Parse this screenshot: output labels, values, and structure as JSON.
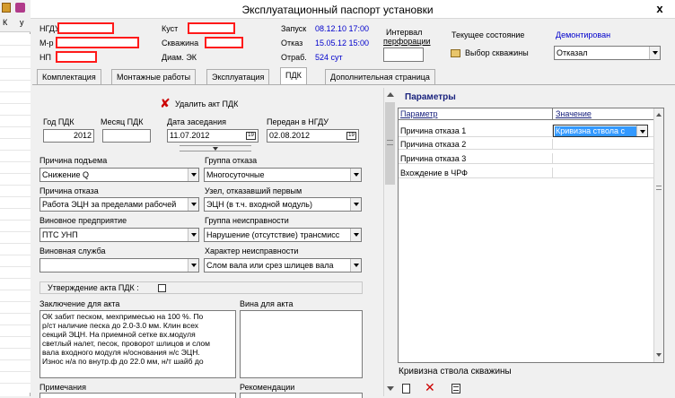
{
  "window": {
    "title": "Эксплуатационный паспорт установки",
    "close_label": "x"
  },
  "header": {
    "ngdu_label": "НГДУ",
    "mr_label": "М-р",
    "np_label": "НП",
    "kust_label": "Куст",
    "skv_label": "Скважина",
    "diam_label": "Диам. ЭК",
    "zapusk_label": "Запуск",
    "zapusk_value": "08.12.10 17:00",
    "otkaz_label": "Отказ",
    "otkaz_value": "15.05.12 15:00",
    "otrab_label": "Отраб.",
    "otrab_value": "524 сут",
    "interval_label_1": "Интервал",
    "interval_label_2": "перфорации",
    "state_label": "Текущее состояние",
    "state_value": "Демонтирован",
    "choose_well_label": "Выбор скважины",
    "status_combo_value": "Отказал"
  },
  "tabs": [
    {
      "label": "Комплектация"
    },
    {
      "label": "Монтажные работы"
    },
    {
      "label": "Эксплуатация"
    },
    {
      "label": "ПДК"
    },
    {
      "label": "Дополнительная страница"
    }
  ],
  "left_strip": {
    "label_1": "К",
    "label_2": "у"
  },
  "pdk": {
    "delete_label": "Удалить акт ПДК",
    "year_label": "Год ПДК",
    "year_value": "2012",
    "month_label": "Месяц ПДК",
    "month_value": "",
    "meeting_date_label": "Дата заседания",
    "meeting_date_value": "11.07.2012",
    "transfer_label": "Передан в НГДУ",
    "transfer_value": "02.08.2012",
    "lift_reason_label": "Причина подъема",
    "lift_reason_value": "Снижение Q",
    "failure_group_label": "Группа отказа",
    "failure_group_value": "Многосуточные",
    "failure_reason_label": "Причина отказа",
    "failure_reason_value": "Работа ЭЦН за пределами рабочей",
    "first_node_label": "Узел, отказавший первым",
    "first_node_value": "ЭЦН (в т.ч. входной модуль)",
    "culprit_label": "Виновное предприятие",
    "culprit_value": "ПТС УНП",
    "malfunction_group_label": "Группа неисправности",
    "malfunction_group_value": "Нарушение (отсутствие) трансмисс",
    "culprit_service_label": "Виновная служба",
    "culprit_service_value": "",
    "malfunction_char_label": "Характер неисправности",
    "malfunction_char_value": "Слом вала или срез шлицев вала",
    "approval_label": "Утверждение акта ПДК :",
    "conclusion_label": "Заключение для акта",
    "conclusion_lines": [
      "ОК забит песком, мехпримесью на 100 %. По",
      "р/ст наличие песка до 2.0-3.0 мм. Клин всех",
      "секций ЭЦН. На приемной сетке вх.модуля",
      "светлый налет, песок, проворот шлицов и слом",
      "вала входного модуля н/основания н/с ЭЦН.",
      "Износ н/а по внутр.ф до 22.0 мм, н/т шайб до"
    ],
    "guilt_label": "Вина для акта",
    "notes_label": "Примечания",
    "recommend_label": "Рекомендации"
  },
  "params": {
    "title": "Параметры",
    "col_param": "Параметр",
    "col_value": "Значение",
    "rows": [
      {
        "name": "Причина отказа 1",
        "value": "Кривизна ствола с"
      },
      {
        "name": "Причина отказа 2",
        "value": ""
      },
      {
        "name": "Причина отказа 3",
        "value": ""
      },
      {
        "name": "Вхождение в ЧРФ",
        "value": ""
      }
    ],
    "footer_text": "Кривизна ствола скважины"
  },
  "colors": {
    "title_bar": "#ffffff",
    "highlight": "#3399ff",
    "link_blue": "#0000cc",
    "red": "#ff1a1a"
  }
}
